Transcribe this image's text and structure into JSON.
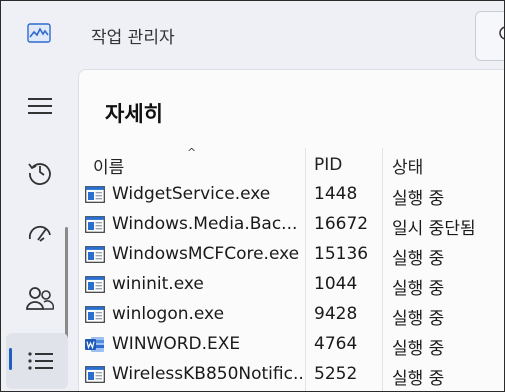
{
  "app": {
    "title": "작업 관리자"
  },
  "page": {
    "title": "자세히"
  },
  "columns": {
    "name": "이름",
    "pid": "PID",
    "status": "상태"
  },
  "rows": [
    {
      "name": "WidgetService.exe",
      "pid": "1448",
      "status": "실행 중",
      "icon": "app-window-icon"
    },
    {
      "name": "Windows.Media.Bac...",
      "pid": "16672",
      "status": "일시 중단됨",
      "icon": "app-window-icon"
    },
    {
      "name": "WindowsMCFCore.exe",
      "pid": "15136",
      "status": "실행 중",
      "icon": "app-window-icon"
    },
    {
      "name": "wininit.exe",
      "pid": "1044",
      "status": "실행 중",
      "icon": "app-window-icon"
    },
    {
      "name": "winlogon.exe",
      "pid": "9428",
      "status": "실행 중",
      "icon": "app-window-icon"
    },
    {
      "name": "WINWORD.EXE",
      "pid": "4764",
      "status": "실행 중",
      "icon": "word-icon"
    },
    {
      "name": "WirelessKB850Notific...",
      "pid": "5252",
      "status": "실행 중",
      "icon": "app-window-icon"
    }
  ],
  "colors": {
    "accent": "#1f5fbf",
    "word": "#1e5bb8"
  }
}
